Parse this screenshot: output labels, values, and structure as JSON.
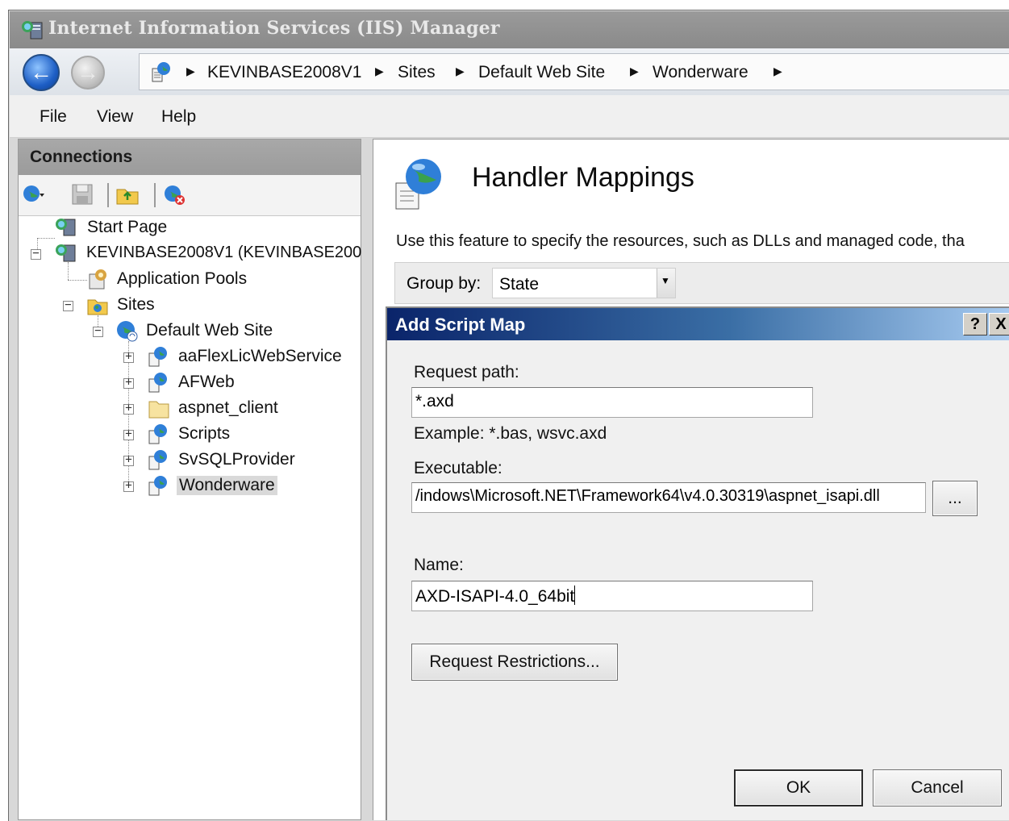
{
  "window": {
    "title": "Internet Information Services (IIS) Manager"
  },
  "nav": {
    "breadcrumbs": [
      "KEVINBASE2008V1",
      "Sites",
      "Default Web Site",
      "Wonderware"
    ]
  },
  "menu": {
    "items": [
      "File",
      "View",
      "Help"
    ]
  },
  "connections": {
    "header": "Connections",
    "toolbar_icons": [
      "connect-icon",
      "save-icon",
      "up-folder-icon",
      "delete-connection-icon"
    ],
    "tree": {
      "start_page": "Start Page",
      "server": "KEVINBASE2008V1 (KEVINBASE200",
      "app_pools": "Application Pools",
      "sites": "Sites",
      "default_site": "Default Web Site",
      "children": [
        "aaFlexLicWebService",
        "AFWeb",
        "aspnet_client",
        "Scripts",
        "SvSQLProvider",
        "Wonderware"
      ],
      "selected": "Wonderware"
    }
  },
  "main": {
    "title": "Handler Mappings",
    "description": "Use this feature to specify the resources, such as DLLs and managed code, tha",
    "group_by_label": "Group by:",
    "group_by_value": "State"
  },
  "dialog": {
    "title": "Add Script Map",
    "help_btn": "?",
    "close_btn": "X",
    "request_path_label": "Request path:",
    "request_path_value": "*.axd",
    "example": "Example: *.bas, wsvc.axd",
    "executable_label": "Executable:",
    "executable_value": "/indows\\Microsoft.NET\\Framework64\\v4.0.30319\\aspnet_isapi.dll",
    "browse_label": "...",
    "name_label": "Name:",
    "name_value": "AXD-ISAPI-4.0_64bit",
    "restrictions_label": "Request Restrictions...",
    "ok_label": "OK",
    "cancel_label": "Cancel"
  }
}
